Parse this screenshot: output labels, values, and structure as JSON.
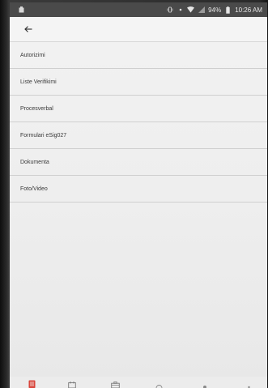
{
  "status_bar": {
    "battery": "94%",
    "time": "10:26 AM"
  },
  "app_bar": {
    "back_icon": "arrow-left-icon"
  },
  "menu": {
    "items": [
      {
        "label": "Autorizimi"
      },
      {
        "label": "Liste Verifikimi"
      },
      {
        "label": "Procesverbal"
      },
      {
        "label": "Formulari eSig027"
      },
      {
        "label": "Dokumenta"
      },
      {
        "label": "Foto/Video"
      }
    ]
  },
  "bottom_nav": {
    "items": [
      {
        "icon": "document-icon",
        "active": true
      },
      {
        "icon": "calendar-icon",
        "active": false
      },
      {
        "icon": "briefcase-icon",
        "active": false
      },
      {
        "icon": "search-icon",
        "active": false
      },
      {
        "icon": "person-icon",
        "active": false
      },
      {
        "icon": "more-icon",
        "active": false
      }
    ]
  },
  "colors": {
    "accent": "#d9453b",
    "status_bar": "#4a4a4a",
    "background": "#f0f0f0",
    "divider": "#cfcfcf",
    "text": "#3a3a3a"
  }
}
